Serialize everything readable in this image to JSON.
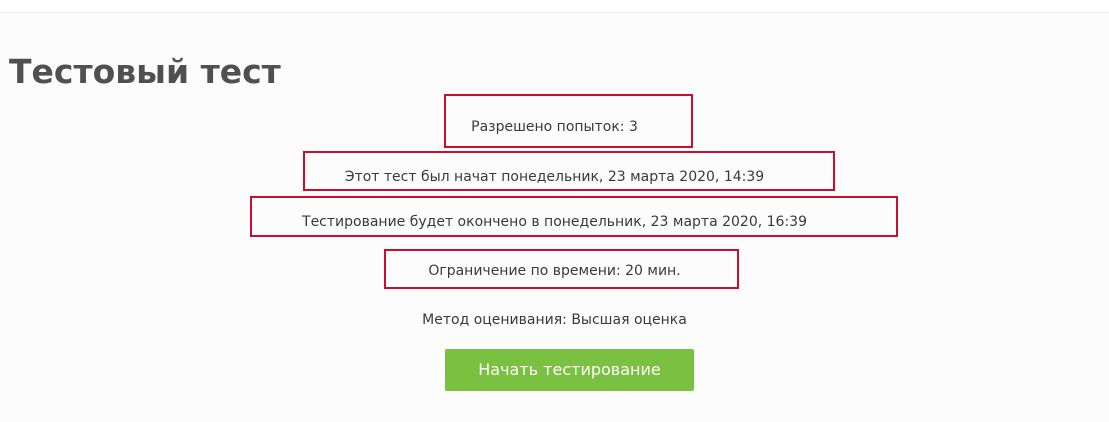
{
  "quiz": {
    "title": "Тестовый тест",
    "info": {
      "attempts_allowed": "Разрешено попыток: 3",
      "opened": "Этот тест был начат понедельник, 23 марта 2020, 14:39",
      "closes": "Тестирование будет окончено в понедельник, 23 марта 2020, 16:39",
      "time_limit": "Ограничение по времени: 20 мин.",
      "grading_method": "Метод оценивания: Высшая оценка"
    },
    "start_button_label": "Начать тестирование"
  },
  "colors": {
    "highlight_border": "#c8102e",
    "button_background": "#7ac142",
    "title_text": "#505050"
  }
}
